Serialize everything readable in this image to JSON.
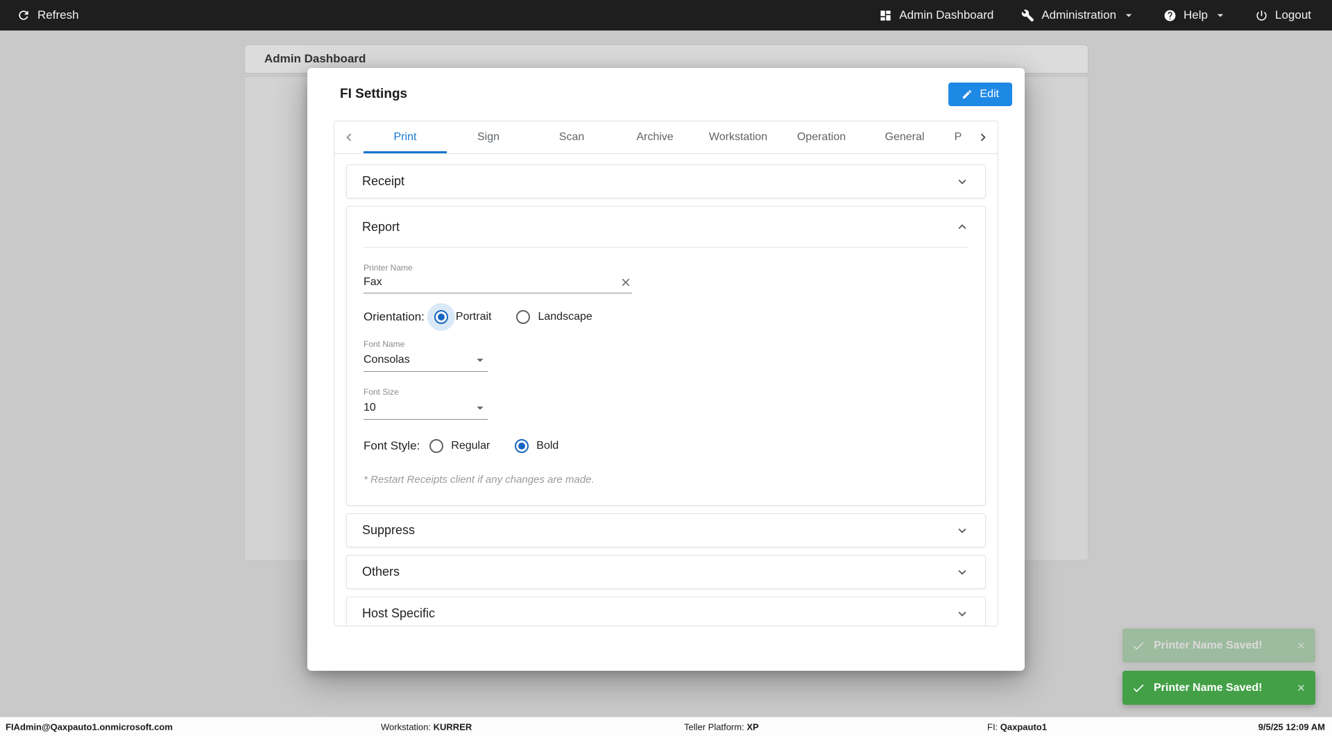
{
  "topbar": {
    "refresh": "Refresh",
    "admin_dashboard": "Admin Dashboard",
    "administration": "Administration",
    "help": "Help",
    "logout": "Logout"
  },
  "page": {
    "panel_title": "Admin Dashboard"
  },
  "modal": {
    "title": "FI Settings",
    "edit_button": "Edit",
    "tabs": [
      "Print",
      "Sign",
      "Scan",
      "Archive",
      "Workstation",
      "Operation",
      "General",
      "P"
    ],
    "active_tab": "Print",
    "sections": {
      "receipt": "Receipt",
      "report": "Report",
      "suppress": "Suppress",
      "others": "Others",
      "host_specific": "Host Specific"
    },
    "report": {
      "printer_name_label": "Printer Name",
      "printer_name_value": "Fax",
      "orientation_label": "Orientation:",
      "orientation_options": [
        "Portrait",
        "Landscape"
      ],
      "orientation_selected": "Portrait",
      "font_name_label": "Font Name",
      "font_name_value": "Consolas",
      "font_size_label": "Font Size",
      "font_size_value": "10",
      "font_style_label": "Font Style:",
      "font_style_options": [
        "Regular",
        "Bold"
      ],
      "font_style_selected": "Bold",
      "note": "* Restart Receipts client if any changes are made."
    }
  },
  "toasts": [
    {
      "message": "Printer Name Saved!",
      "state": "fading"
    },
    {
      "message": "Printer Name Saved!",
      "state": "visible"
    }
  ],
  "statusbar": {
    "user": "FIAdmin@Qaxpauto1.onmicrosoft.com",
    "workstation_label": "Workstation:",
    "workstation_value": "KURRER",
    "platform_label": "Teller Platform:",
    "platform_value": "XP",
    "fi_label": "FI:",
    "fi_value": "Qaxpauto1",
    "datetime": "9/5/25 12:09 AM"
  },
  "icons": {
    "refresh": "⟳",
    "dashboard": "▦",
    "administration_wrench": "🔧",
    "help_question": "?",
    "logout_power": "⏻",
    "edit_pencil": "✎",
    "chevron_down": "⌄",
    "chevron_up": "⌃",
    "chevron_left": "❮",
    "chevron_right": "❯",
    "clear_x": "✕",
    "check": "✓",
    "caret_down": "▾"
  },
  "colors": {
    "accent_blue": "#1976d2",
    "edit_button_blue": "#1e88e5",
    "toast_green": "#43a047",
    "topbar_bg": "#1e1e1e"
  }
}
